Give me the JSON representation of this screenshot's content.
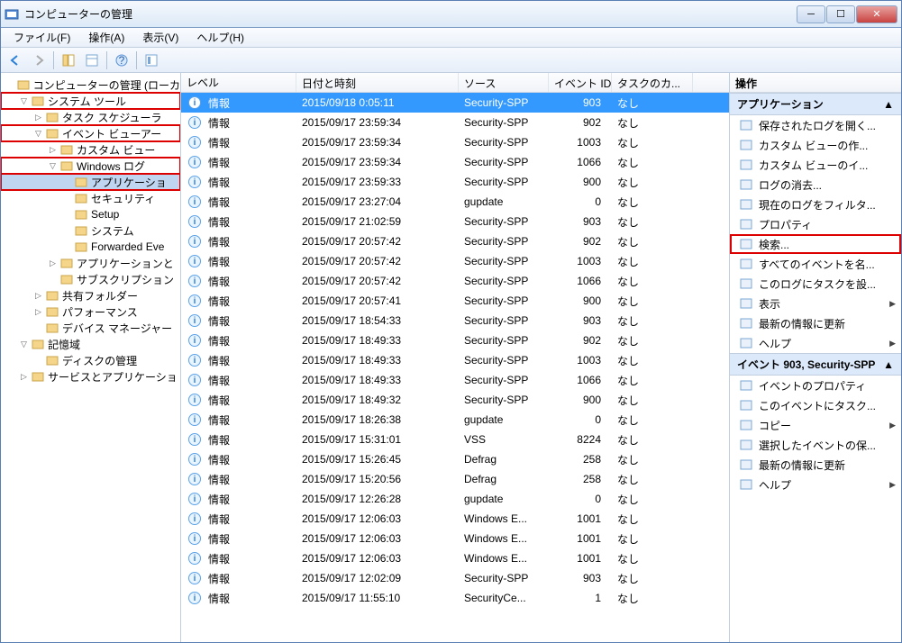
{
  "title": "コンピューターの管理",
  "menu": {
    "file": "ファイル(F)",
    "action": "操作(A)",
    "view": "表示(V)",
    "help": "ヘルプ(H)"
  },
  "tree": [
    {
      "ind": 0,
      "exp": "",
      "label": "コンピューターの管理 (ローカ",
      "sel": false
    },
    {
      "ind": 1,
      "exp": "▽",
      "label": "システム ツール",
      "sel": false,
      "box": true
    },
    {
      "ind": 2,
      "exp": "▷",
      "label": "タスク スケジューラ",
      "sel": false
    },
    {
      "ind": 2,
      "exp": "▽",
      "label": "イベント ビューアー",
      "sel": false,
      "box": true
    },
    {
      "ind": 3,
      "exp": "▷",
      "label": "カスタム ビュー",
      "sel": false
    },
    {
      "ind": 3,
      "exp": "▽",
      "label": "Windows ログ",
      "sel": false,
      "box": true
    },
    {
      "ind": 4,
      "exp": "",
      "label": "アプリケーショ",
      "sel": true,
      "box": true
    },
    {
      "ind": 4,
      "exp": "",
      "label": "セキュリティ",
      "sel": false
    },
    {
      "ind": 4,
      "exp": "",
      "label": "Setup",
      "sel": false
    },
    {
      "ind": 4,
      "exp": "",
      "label": "システム",
      "sel": false
    },
    {
      "ind": 4,
      "exp": "",
      "label": "Forwarded Eve",
      "sel": false
    },
    {
      "ind": 3,
      "exp": "▷",
      "label": "アプリケーションと",
      "sel": false
    },
    {
      "ind": 3,
      "exp": "",
      "label": "サブスクリプション",
      "sel": false
    },
    {
      "ind": 2,
      "exp": "▷",
      "label": "共有フォルダー",
      "sel": false
    },
    {
      "ind": 2,
      "exp": "▷",
      "label": "パフォーマンス",
      "sel": false
    },
    {
      "ind": 2,
      "exp": "",
      "label": "デバイス マネージャー",
      "sel": false
    },
    {
      "ind": 1,
      "exp": "▽",
      "label": "記憶域",
      "sel": false
    },
    {
      "ind": 2,
      "exp": "",
      "label": "ディスクの管理",
      "sel": false
    },
    {
      "ind": 1,
      "exp": "▷",
      "label": "サービスとアプリケーショ",
      "sel": false
    }
  ],
  "columns": {
    "level": "レベル",
    "date": "日付と時刻",
    "source": "ソース",
    "id": "イベント ID",
    "task": "タスクのカ..."
  },
  "info_label": "情報",
  "none_label": "なし",
  "events": [
    {
      "dt": "2015/09/18 0:05:11",
      "src": "Security-SPP",
      "id": 903,
      "sel": true
    },
    {
      "dt": "2015/09/17 23:59:34",
      "src": "Security-SPP",
      "id": 902
    },
    {
      "dt": "2015/09/17 23:59:34",
      "src": "Security-SPP",
      "id": 1003
    },
    {
      "dt": "2015/09/17 23:59:34",
      "src": "Security-SPP",
      "id": 1066
    },
    {
      "dt": "2015/09/17 23:59:33",
      "src": "Security-SPP",
      "id": 900
    },
    {
      "dt": "2015/09/17 23:27:04",
      "src": "gupdate",
      "id": 0
    },
    {
      "dt": "2015/09/17 21:02:59",
      "src": "Security-SPP",
      "id": 903
    },
    {
      "dt": "2015/09/17 20:57:42",
      "src": "Security-SPP",
      "id": 902
    },
    {
      "dt": "2015/09/17 20:57:42",
      "src": "Security-SPP",
      "id": 1003
    },
    {
      "dt": "2015/09/17 20:57:42",
      "src": "Security-SPP",
      "id": 1066
    },
    {
      "dt": "2015/09/17 20:57:41",
      "src": "Security-SPP",
      "id": 900
    },
    {
      "dt": "2015/09/17 18:54:33",
      "src": "Security-SPP",
      "id": 903
    },
    {
      "dt": "2015/09/17 18:49:33",
      "src": "Security-SPP",
      "id": 902
    },
    {
      "dt": "2015/09/17 18:49:33",
      "src": "Security-SPP",
      "id": 1003
    },
    {
      "dt": "2015/09/17 18:49:33",
      "src": "Security-SPP",
      "id": 1066
    },
    {
      "dt": "2015/09/17 18:49:32",
      "src": "Security-SPP",
      "id": 900
    },
    {
      "dt": "2015/09/17 18:26:38",
      "src": "gupdate",
      "id": 0
    },
    {
      "dt": "2015/09/17 15:31:01",
      "src": "VSS",
      "id": 8224
    },
    {
      "dt": "2015/09/17 15:26:45",
      "src": "Defrag",
      "id": 258
    },
    {
      "dt": "2015/09/17 15:20:56",
      "src": "Defrag",
      "id": 258
    },
    {
      "dt": "2015/09/17 12:26:28",
      "src": "gupdate",
      "id": 0
    },
    {
      "dt": "2015/09/17 12:06:03",
      "src": "Windows E...",
      "id": 1001
    },
    {
      "dt": "2015/09/17 12:06:03",
      "src": "Windows E...",
      "id": 1001
    },
    {
      "dt": "2015/09/17 12:06:03",
      "src": "Windows E...",
      "id": 1001
    },
    {
      "dt": "2015/09/17 12:02:09",
      "src": "Security-SPP",
      "id": 903
    },
    {
      "dt": "2015/09/17 11:55:10",
      "src": "SecurityCe...",
      "id": 1
    }
  ],
  "actions_header": "操作",
  "group1": "アプリケーション",
  "actions1": [
    {
      "label": "保存されたログを開く..."
    },
    {
      "label": "カスタム ビューの作..."
    },
    {
      "label": "カスタム ビューのイ..."
    },
    {
      "label": "ログの消去..."
    },
    {
      "label": "現在のログをフィルタ..."
    },
    {
      "label": "プロパティ"
    },
    {
      "label": "検索...",
      "box": true
    },
    {
      "label": "すべてのイベントを名..."
    },
    {
      "label": "このログにタスクを設..."
    },
    {
      "label": "表示",
      "sub": true
    },
    {
      "label": "最新の情報に更新"
    },
    {
      "label": "ヘルプ",
      "sub": true
    }
  ],
  "group2": "イベント 903, Security-SPP",
  "actions2": [
    {
      "label": "イベントのプロパティ"
    },
    {
      "label": "このイベントにタスク..."
    },
    {
      "label": "コピー",
      "sub": true
    },
    {
      "label": "選択したイベントの保..."
    },
    {
      "label": "最新の情報に更新"
    },
    {
      "label": "ヘルプ",
      "sub": true
    }
  ]
}
